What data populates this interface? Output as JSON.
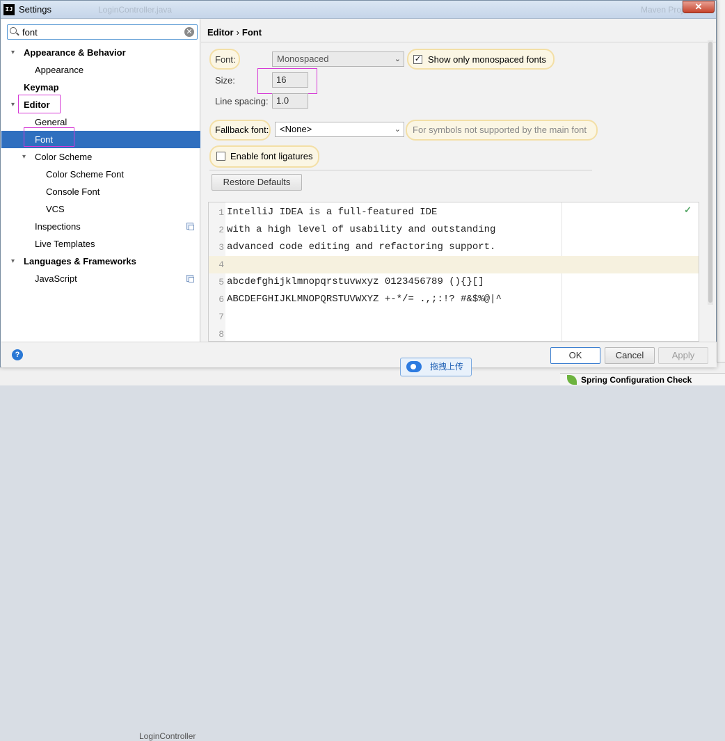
{
  "window": {
    "title": "Settings",
    "close_label": "✕",
    "ghost_tab": "LoginController.java",
    "ghost_right": "Maven Projects"
  },
  "search": {
    "value": "font",
    "clear_label": "✕"
  },
  "tree": {
    "appearance_behavior": "Appearance & Behavior",
    "appearance": "Appearance",
    "keymap": "Keymap",
    "editor": "Editor",
    "general": "General",
    "font": "Font",
    "color_scheme": "Color Scheme",
    "color_scheme_font": "Color Scheme Font",
    "console_font": "Console Font",
    "vcs": "VCS",
    "inspections": "Inspections",
    "live_templates": "Live Templates",
    "languages_frameworks": "Languages & Frameworks",
    "javascript": "JavaScript"
  },
  "breadcrumb": {
    "parent": "Editor",
    "separator": "›",
    "current": "Font"
  },
  "font_settings": {
    "font_label": "Font:",
    "font_value": "Monospaced",
    "show_mono_label": "Show only monospaced fonts",
    "show_mono_checked": true,
    "size_label": "Size:",
    "size_value": "16",
    "line_spacing_label": "Line spacing:",
    "line_spacing_value": "1.0",
    "fallback_label": "Fallback font:",
    "fallback_value": "<None>",
    "fallback_hint": "For symbols not supported by the main font",
    "ligatures_label": "Enable font ligatures",
    "ligatures_checked": false,
    "restore_label": "Restore Defaults"
  },
  "preview": {
    "lines": [
      {
        "n": "1",
        "text": "IntelliJ IDEA is a full-featured IDE"
      },
      {
        "n": "2",
        "text": "with a high level of usability and outstanding"
      },
      {
        "n": "3",
        "text": "advanced code editing and refactoring support."
      },
      {
        "n": "4",
        "text": ""
      },
      {
        "n": "5",
        "text": "abcdefghijklmnopqrstuvwxyz 0123456789 (){}[]"
      },
      {
        "n": "6",
        "text": "ABCDEFGHIJKLMNOPQRSTUVWXYZ +-*/= .,;:!? #&$%@|^"
      },
      {
        "n": "7",
        "text": ""
      },
      {
        "n": "8",
        "text": ""
      }
    ],
    "ok_mark": "✓"
  },
  "footer": {
    "help": "?",
    "ok": "OK",
    "cancel": "Cancel",
    "apply": "Apply",
    "upload": "拖拽上传"
  },
  "background": {
    "bottom_text": "LoginController",
    "spring": "Spring Configuration Check"
  }
}
